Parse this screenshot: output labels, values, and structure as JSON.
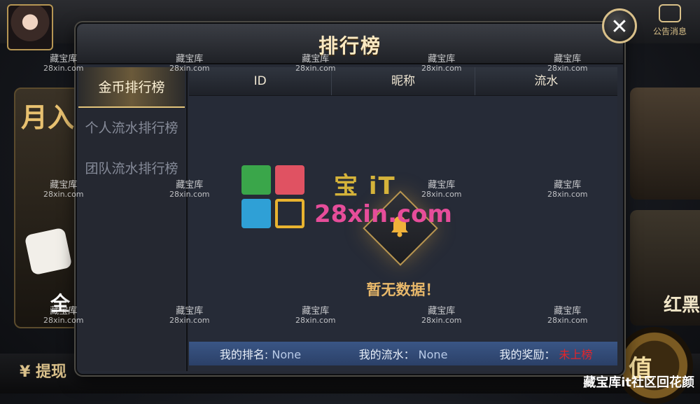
{
  "background": {
    "notice_label": "公告消息",
    "left_card_big": "月入",
    "left_card_small": "全",
    "right_card_text": "红黑",
    "withdraw_label": "提现",
    "recharge_label": "值"
  },
  "modal": {
    "title": "排行榜",
    "close_symbol": "✕",
    "tabs": [
      {
        "label": "金币排行榜",
        "active": true
      },
      {
        "label": "个人流水排行榜",
        "active": false
      },
      {
        "label": "团队流水排行榜",
        "active": false
      }
    ],
    "columns": [
      "ID",
      "昵称",
      "流水"
    ],
    "empty_text": "暂无数据！",
    "footer": {
      "rank_label": "我的排名:",
      "rank_value": "None",
      "flow_label": "我的流水：",
      "flow_value": "None",
      "reward_label": "我的奖励：",
      "reward_value": "未上榜"
    }
  },
  "watermark": {
    "line1": "藏宝库",
    "line2": "28xin.com",
    "logo_text1": "宝 iT",
    "logo_text2": "28xin.com",
    "corner": "藏宝库it社区回花颜"
  },
  "colors": {
    "accent_gold": "#e3c47a",
    "footer_blue": "#3a5685",
    "reward_red": "#e2252b"
  }
}
